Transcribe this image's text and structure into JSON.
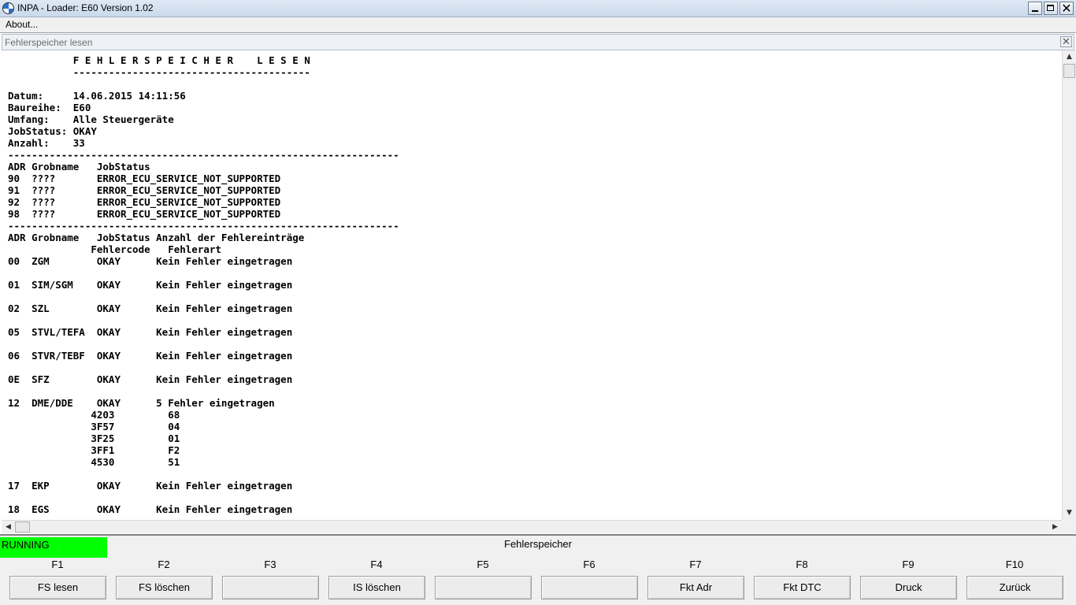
{
  "window": {
    "title": "INPA - Loader:  E60 Version 1.02"
  },
  "menu": {
    "about_label": "About..."
  },
  "child_window": {
    "title": "Fehlerspeicher lesen",
    "close_glyph": "✕"
  },
  "report": {
    "lines": [
      "           F E H L E R S P E I C H E R    L E S E N",
      "           ----------------------------------------",
      "",
      "Datum:     14.06.2015 14:11:56",
      "Baureihe:  E60",
      "Umfang:    Alle Steuergeräte",
      "JobStatus: OKAY",
      "Anzahl:    33",
      "------------------------------------------------------------------",
      "ADR Grobname   JobStatus",
      "90  ????       ERROR_ECU_SERVICE_NOT_SUPPORTED",
      "91  ????       ERROR_ECU_SERVICE_NOT_SUPPORTED",
      "92  ????       ERROR_ECU_SERVICE_NOT_SUPPORTED",
      "98  ????       ERROR_ECU_SERVICE_NOT_SUPPORTED",
      "------------------------------------------------------------------",
      "ADR Grobname   JobStatus Anzahl der Fehlereinträge",
      "              Fehlercode   Fehlerart",
      "00  ZGM        OKAY      Kein Fehler eingetragen",
      "",
      "01  SIM/SGM    OKAY      Kein Fehler eingetragen",
      "",
      "02  SZL        OKAY      Kein Fehler eingetragen",
      "",
      "05  STVL/TEFA  OKAY      Kein Fehler eingetragen",
      "",
      "06  STVR/TEBF  OKAY      Kein Fehler eingetragen",
      "",
      "0E  SFZ        OKAY      Kein Fehler eingetragen",
      "",
      "12  DME/DDE    OKAY      5 Fehler eingetragen",
      "              4203         68",
      "              3F57         04",
      "              3F25         01",
      "              3FF1         F2",
      "              4530         51",
      "",
      "17  EKP        OKAY      Kein Fehler eingetragen",
      "",
      "18  EGS        OKAY      Kein Fehler eingetragen"
    ]
  },
  "status": {
    "state": "RUNNING",
    "state_color": "#00ff00",
    "title": "Fehlerspeicher"
  },
  "function_keys": [
    {
      "key": "F1",
      "label": "FS lesen"
    },
    {
      "key": "F2",
      "label": "FS löschen"
    },
    {
      "key": "F3",
      "label": ""
    },
    {
      "key": "F4",
      "label": "IS löschen"
    },
    {
      "key": "F5",
      "label": ""
    },
    {
      "key": "F6",
      "label": ""
    },
    {
      "key": "F7",
      "label": "Fkt Adr"
    },
    {
      "key": "F8",
      "label": "Fkt DTC"
    },
    {
      "key": "F9",
      "label": "Druck"
    },
    {
      "key": "F10",
      "label": "Zurück"
    }
  ],
  "icons": {
    "app": "bmw-logo-icon",
    "minimize": "minimize-icon",
    "maximize": "maximize-icon",
    "close": "close-icon",
    "scroll_up": "arrow-up-icon",
    "scroll_down": "arrow-down-icon",
    "scroll_left": "arrow-left-icon",
    "scroll_right": "arrow-right-icon"
  }
}
